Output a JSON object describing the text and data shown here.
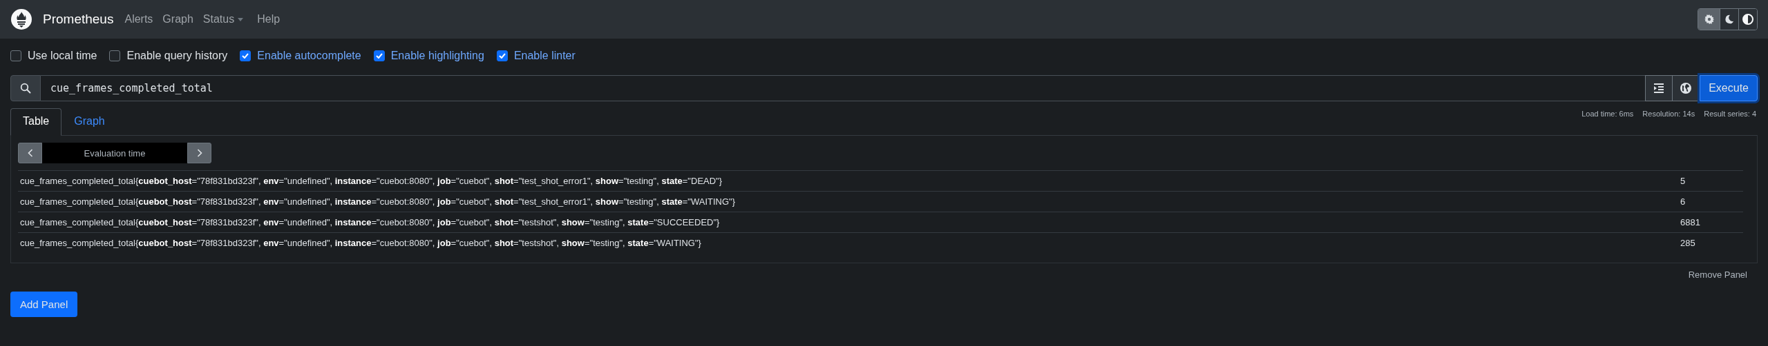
{
  "navbar": {
    "brand": "Prometheus",
    "links": [
      {
        "label": "Alerts",
        "kind": "link"
      },
      {
        "label": "Graph",
        "kind": "link"
      },
      {
        "label": "Status",
        "kind": "dropdown"
      },
      {
        "label": "Help",
        "kind": "link"
      }
    ],
    "theme_buttons": [
      {
        "kind": "gear",
        "selected": true
      },
      {
        "kind": "moon",
        "selected": false
      },
      {
        "kind": "contrast",
        "selected": false
      }
    ]
  },
  "options": [
    {
      "label": "Use local time",
      "checked": false
    },
    {
      "label": "Enable query history",
      "checked": false
    },
    {
      "label": "Enable autocomplete",
      "checked": true
    },
    {
      "label": "Enable highlighting",
      "checked": true
    },
    {
      "label": "Enable linter",
      "checked": true
    }
  ],
  "query": {
    "value": "cue_frames_completed_total",
    "execute": "Execute"
  },
  "stats": [
    "Load time: 6ms",
    "Resolution: 14s",
    "Result series: 4"
  ],
  "tabs": [
    {
      "label": "Table",
      "selected": true
    },
    {
      "label": "Graph",
      "selected": false
    }
  ],
  "evaluation_time": {
    "placeholder": "Evaluation time"
  },
  "rows": [
    {
      "metric": "cue_frames_completed_total{**cuebot_host**=\"78f831bd323f\", **env**=\"undefined\", **instance**=\"cuebot:8080\", **job**=\"cuebot\", **shot**=\"test_shot_error1\", **show**=\"testing\", **state**=\"DEAD\"}",
      "value": "5"
    },
    {
      "metric": "cue_frames_completed_total{**cuebot_host**=\"78f831bd323f\", **env**=\"undefined\", **instance**=\"cuebot:8080\", **job**=\"cuebot\", **shot**=\"test_shot_error1\", **show**=\"testing\", **state**=\"WAITING\"}",
      "value": "6"
    },
    {
      "metric": "cue_frames_completed_total{**cuebot_host**=\"78f831bd323f\", **env**=\"undefined\", **instance**=\"cuebot:8080\", **job**=\"cuebot\", **shot**=\"testshot\", **show**=\"testing\", **state**=\"SUCCEEDED\"}",
      "value": "6881"
    },
    {
      "metric": "cue_frames_completed_total{**cuebot_host**=\"78f831bd323f\", **env**=\"undefined\", **instance**=\"cuebot:8080\", **job**=\"cuebot\", **shot**=\"testshot\", **show**=\"testing\", **state**=\"WAITING\"}",
      "value": "285"
    }
  ],
  "remove_panel": "Remove Panel",
  "add_panel": "Add Panel"
}
